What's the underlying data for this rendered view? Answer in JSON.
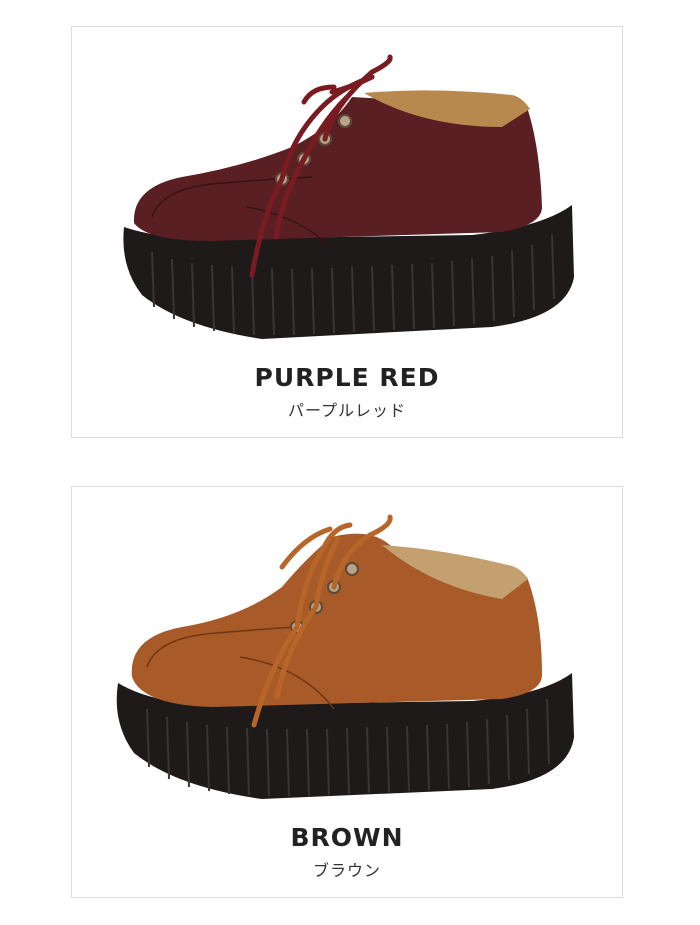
{
  "products": [
    {
      "color_name": "PURPLE RED",
      "color_name_kana": "パープルレッド",
      "leather_color": "#5a1f23",
      "lace_color": "#7a1b22"
    },
    {
      "color_name": "BROWN",
      "color_name_kana": "ブラウン",
      "leather_color": "#a85a28",
      "lace_color": "#b8652a"
    }
  ]
}
